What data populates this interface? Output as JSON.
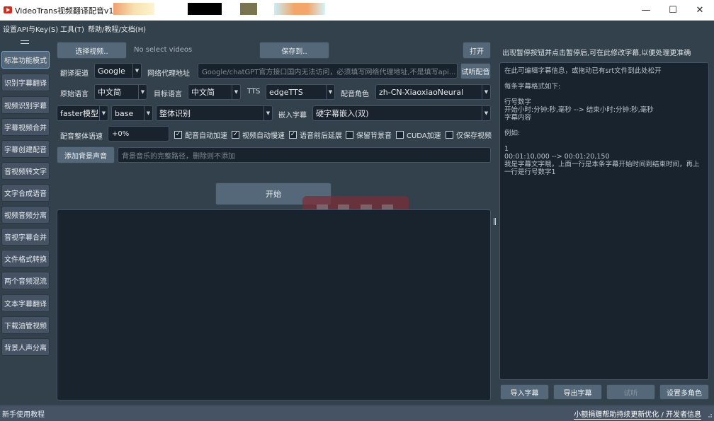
{
  "window": {
    "title": "VideoTrans视频翻译配音v1.26",
    "controls": [
      "—",
      "☐",
      "✕"
    ]
  },
  "menu": [
    "设置API与Key(S)",
    "工具(T)",
    "帮助/教程/文档(H)"
  ],
  "sidebar": {
    "items": [
      {
        "label": "标准功能模式",
        "active": true
      },
      {
        "label": "识别字幕翻译"
      },
      {
        "label": "视频识别字幕"
      },
      {
        "label": "字幕视频合并"
      },
      {
        "label": "字幕创建配音"
      },
      {
        "label": "音视频转文字"
      },
      {
        "label": "文字合成语音"
      },
      {
        "label": "视频音频分离"
      },
      {
        "label": "音视字幕合并"
      },
      {
        "label": "文件格式转换"
      },
      {
        "label": "两个音频混流"
      },
      {
        "label": "文本字幕翻译"
      },
      {
        "label": "下载油管视频"
      },
      {
        "label": "背景人声分离"
      }
    ]
  },
  "main": {
    "select_video_btn": "选择视频..",
    "no_video_text": "No select videos",
    "save_to_btn": "保存到..",
    "open_btn": "打开",
    "translate_channel_label": "翻译渠道",
    "translate_channel_value": "Google",
    "proxy_label": "网络代理地址",
    "proxy_placeholder": "Google/chatGPT官方接口国内无法访问，必须填写网络代理地址,不是填写api...",
    "test_dub_btn": "试听配音",
    "source_lang_label": "原始语言",
    "source_lang_value": "中文简",
    "target_lang_label": "目标语言",
    "target_lang_value": "中文简",
    "tts_label": "TTS",
    "tts_value": "edgeTTS",
    "voice_role_label": "配音角色",
    "voice_role_value": "zh-CN-XiaoxiaoNeural",
    "model_type_value": "faster模型",
    "model_size_value": "base",
    "recognize_mode_value": "整体识别",
    "embed_subtitle_label": "嵌入字幕",
    "embed_subtitle_value": "硬字幕嵌入(双)",
    "speed_label": "配音整体语速",
    "speed_value": "+0%",
    "checkboxes": [
      {
        "label": "配音自动加速",
        "checked": true
      },
      {
        "label": "视频自动慢速",
        "checked": true
      },
      {
        "label": "语音前后延展",
        "checked": true
      },
      {
        "label": "保留背景音",
        "checked": false
      },
      {
        "label": "CUDA加速",
        "checked": false
      },
      {
        "label": "仅保存视频",
        "checked": false
      }
    ],
    "add_bgm_btn": "添加背景声音",
    "bgm_placeholder": "背景音乐的完整路径，删除则不添加",
    "start_btn": "开始"
  },
  "right_panel": {
    "hint": "出现暂停按钮并点击暂停后,可在此修改字幕,以便处理更准确",
    "editor_lines": [
      "在此可编辑字幕信息，或拖动已有srt文件到此处松开",
      "",
      "每条字幕格式如下:",
      "",
      "行号数字",
      "开始小时:分钟:秒,毫秒 --> 结束小时:分钟:秒,毫秒",
      "字幕内容",
      "",
      "例如:",
      "",
      "1",
      "00:01:10,000 --> 00:01:20,150",
      "我是字幕文字哦，上面一行是本条字幕开始时间到结束时间，再上一行是行号数字1"
    ],
    "import_btn": "导入字幕",
    "export_btn": "导出字幕",
    "listen_btn": "试听",
    "multi_role_btn": "设置多角色"
  },
  "statusbar": {
    "left": "新手使用教程",
    "right": "小额捐赠帮助持续更新优化 / 开发者信息"
  },
  "colors": {
    "bg": "#32414b",
    "panel": "#19232d",
    "button": "#54687a",
    "border": "#455364"
  }
}
